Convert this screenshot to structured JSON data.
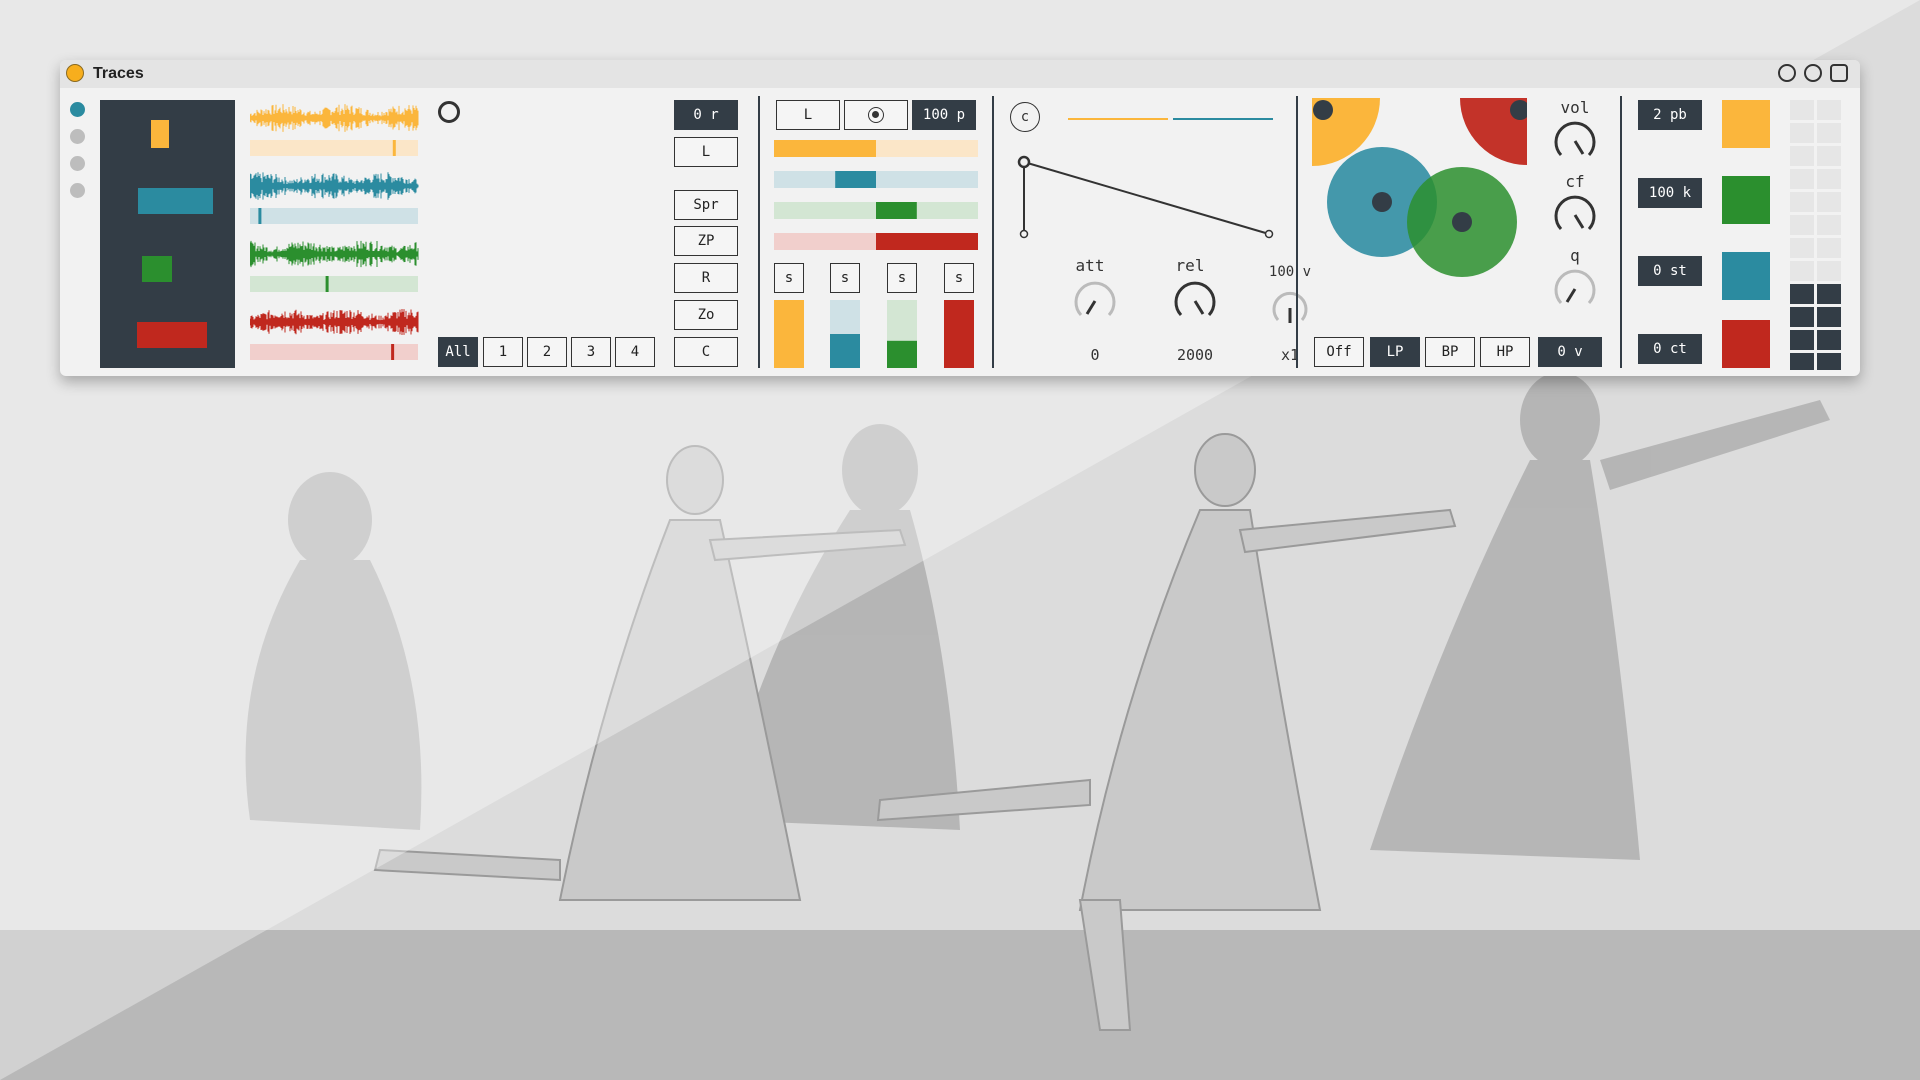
{
  "window": {
    "title": "Traces"
  },
  "colors": {
    "yellow": "#fbb63c",
    "blue": "#2b8ba0",
    "green": "#2b8f2e",
    "red": "#c0281e",
    "dark": "#333d46"
  },
  "track_dots": {
    "selected_index": 0,
    "count": 4
  },
  "sample_panel": {
    "record_button_label": "0 r",
    "loop_button_label": "L",
    "spread_button_label": "Spr",
    "zero_pos_button_label": "ZP",
    "reverse_button_label": "R",
    "zoom_button_label": "Zo",
    "clear_button_label": "C",
    "select_buttons": [
      "All",
      "1",
      "2",
      "3",
      "4"
    ],
    "playheads": [
      0.85,
      0.05,
      0.45,
      0.84
    ]
  },
  "mixer": {
    "loop_label": "L",
    "percent_label": "100 p",
    "solo_labels": [
      "s",
      "s",
      "s",
      "s"
    ],
    "bars": [
      {
        "start": 0.0,
        "end": 0.5
      },
      {
        "start": 0.3,
        "end": 0.5
      },
      {
        "start": 0.5,
        "end": 0.7
      },
      {
        "start": 0.5,
        "end": 1.0
      }
    ],
    "levels": [
      1.0,
      0.5,
      0.4,
      1.0
    ]
  },
  "envelope": {
    "mode_label": "c",
    "att_label": "att",
    "rel_label": "rel",
    "vel_label": "100 v",
    "att_value": "0",
    "rel_value": "2000",
    "mult_value": "x1"
  },
  "filter": {
    "vol_label": "vol",
    "cf_label": "cf",
    "q_label": "q",
    "types": [
      "Off",
      "LP",
      "BP",
      "HP"
    ],
    "active_type": "LP",
    "v_label": "0 v"
  },
  "pitch": {
    "pitchbend_label": "2 pb",
    "k_label": "100 k",
    "semitone_label": "0 st",
    "cents_label": "0 ct"
  }
}
